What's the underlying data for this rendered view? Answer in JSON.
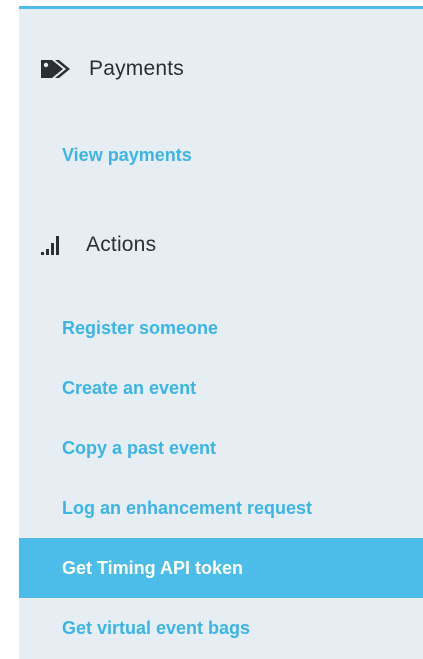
{
  "colors": {
    "panel_bg": "#e7eef3",
    "accent": "#4bbde8",
    "link": "#3bb4e6",
    "heading": "#2b2f33",
    "active_text": "#ffffff"
  },
  "payments": {
    "icon": "tags-icon",
    "title": "Payments",
    "items": [
      {
        "label": "View payments"
      }
    ]
  },
  "actions": {
    "icon": "signal-bars-icon",
    "title": "Actions",
    "items": [
      {
        "label": "Register someone"
      },
      {
        "label": "Create an event"
      },
      {
        "label": "Copy a past event"
      },
      {
        "label": "Log an enhancement request"
      },
      {
        "label": "Get Timing API token",
        "active": true
      },
      {
        "label": "Get virtual event bags"
      }
    ]
  }
}
